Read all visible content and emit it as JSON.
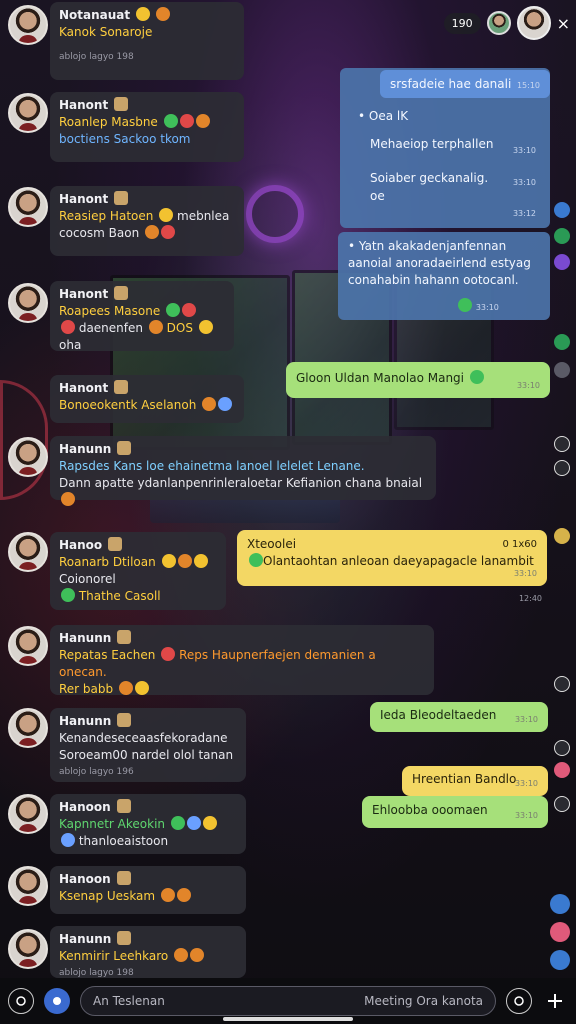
{
  "topbar": {
    "counter": "190",
    "close_glyph": "×"
  },
  "messages_in": [
    {
      "name": "Notanauat",
      "line1": "Kanok Sonaroje",
      "meta": "ablojo lagyo 198"
    },
    {
      "name": "Hanont",
      "line1": "Roanlep Masbne",
      "line2": "boctiens Sackoo tkom"
    },
    {
      "name": "Hanont",
      "line1": "Reasiep Hatoen",
      "line1b": "mebnlea",
      "line2": "cocosm Baon"
    },
    {
      "name": "Hanont",
      "line1": "Roapees Masone",
      "line2": "daenenfen",
      "line2b": "DOS",
      "line2c": "oha"
    },
    {
      "name": "Hanont",
      "line1": "Bonoeokentk Aselanoh"
    },
    {
      "name": "Hanunn",
      "line1": "Rapsdes Kans loe ehainetma lanoel lelelet Lenane.",
      "line2": "Dann apatte ydanlanpenrinleraloetar Kefianion chana bnaial"
    },
    {
      "name": "Hanoo",
      "line1": "Roanarb Dtiloan",
      "line2": "Coionorel",
      "line3": "Thathe Casoll"
    },
    {
      "name": "Hanunn",
      "line1": "Repatas Eachen",
      "line1b": "Reps Haupnerfaejen demanien a onecan.",
      "line2": "Rer babb"
    },
    {
      "name": "Hanunn",
      "line1": "Kenandeseceaasfekoradane",
      "line2": "Soroeam00 nardel olol tanan",
      "meta": "ablojo lagyo 196"
    },
    {
      "name": "Hanoon",
      "line1": "Kapnnetr Akeokin",
      "line2": "thanloeaistoon"
    },
    {
      "name": "Hanoon",
      "line1": "Ksenap Ueskam"
    },
    {
      "name": "Hanunn",
      "line1": "Kenmirir Leehkaro",
      "meta": "ablojo lagyo 198"
    }
  ],
  "blue_panel": {
    "header": "srsfadeie hae danali",
    "header_time": "15:10",
    "bullet1": "• Oea lK",
    "line2": "Mehaeiop terphallen",
    "line2_time": "33:10",
    "line3": "Soiaber geckanalig.",
    "line3b": "oe",
    "line3_time": "33:10",
    "footer_time": "33:12"
  },
  "blue_panel2": {
    "line1": "• Yatn akakadenjanfennan",
    "line2": "aanoial anoradaeirlend estyag",
    "line3": "conahabin hahann ootocanl.",
    "time": "33:10"
  },
  "green1": {
    "text": "Gloon Uldan Manolao Mangi",
    "time": "33:10"
  },
  "yellow1": {
    "header": "Xteoolei",
    "header_right": "0 1x60",
    "text": "Olantaohtan anleoan daeyapagacle lanambit",
    "time": "33:10",
    "below_time": "12:40"
  },
  "green2": {
    "text": "Ieda Bleodeltaeden",
    "time": "33:10"
  },
  "yellow2": {
    "text": "Hreentian Bandlo",
    "time": "33:10"
  },
  "green3": {
    "text": "Ehloobba ooomaen",
    "time": "33:10"
  },
  "bottombar": {
    "placeholder": "An Teslenan",
    "right_hint": "Meeting Ora kanota"
  },
  "colors": {
    "blue_bubble": "#4c74aa",
    "green_bubble": "#a6e07a",
    "yellow_bubble": "#f3d764"
  }
}
